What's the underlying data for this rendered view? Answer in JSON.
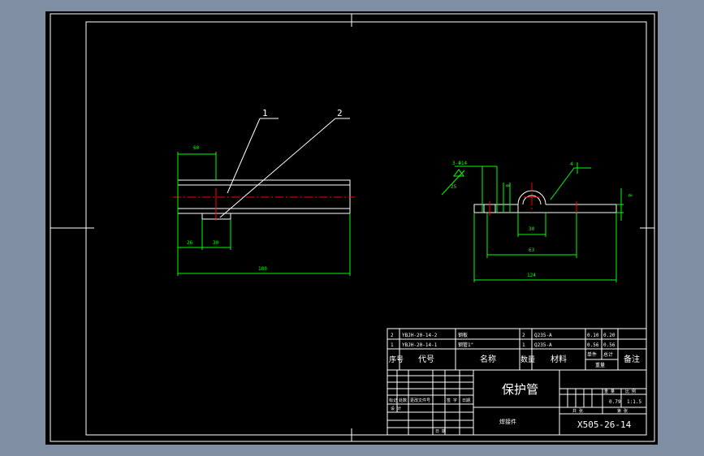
{
  "drawing": {
    "part_balloons": [
      "1",
      "2"
    ],
    "left_view": {
      "dims": [
        "60",
        "26",
        "30",
        "180"
      ]
    },
    "right_view": {
      "callout_holes": "3-Φ14",
      "callout_surface": "25",
      "balloon": "4",
      "dims": [
        "30",
        "63",
        "124",
        "8",
        "8"
      ]
    }
  },
  "bom": {
    "rows": [
      {
        "no": "2",
        "code": "YBJH-20-14-2",
        "name": "钢板",
        "qty": "2",
        "material": "Q235-A",
        "unit": "0.10",
        "total": "0.20"
      },
      {
        "no": "1",
        "code": "YBJH-20-14-1",
        "name": "钢管1\"",
        "qty": "1",
        "material": "Q235-A",
        "unit": "0.56",
        "total": "0.56"
      }
    ],
    "header": {
      "no": "序号",
      "code": "代号",
      "name": "名称",
      "qty": "数量",
      "material": "材料",
      "unit": "单件",
      "total": "总计",
      "weight": "重量",
      "remark": "备注"
    }
  },
  "title_block": {
    "part_name": "保护管",
    "material_note": "焊接件",
    "drawing_no": "X505-26-14",
    "weight": "0.79",
    "scale": "1:1.5",
    "label_weight": "重 量",
    "label_scale": "比 例",
    "label_sheet": "共 张",
    "label_sheet2": "第 张",
    "rev_labels": [
      "标记",
      "处数",
      "更改文件号",
      "签 字",
      "日期"
    ],
    "design_label": "设 计",
    "date_label": "日 期"
  }
}
